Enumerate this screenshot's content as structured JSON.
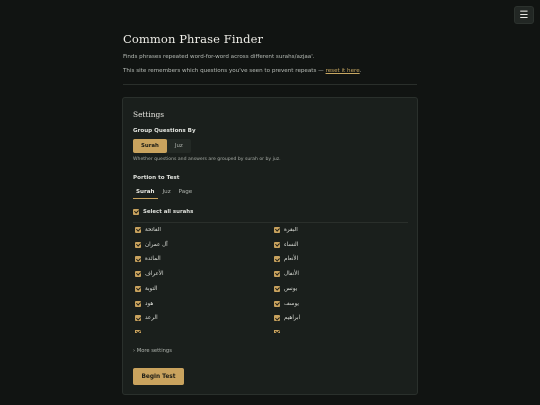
{
  "menu_icon": "☰",
  "header": {
    "title": "Common Phrase Finder",
    "subtitle": "Finds phrases repeated word-for-word across different surahs/azjaa'.",
    "remember_prefix": "This site remembers which questions you've seen to prevent repeats — ",
    "reset_link": "reset it here",
    "remember_suffix": "."
  },
  "settings": {
    "title": "Settings",
    "group_label": "Group Questions By",
    "group_options": [
      "Surah",
      "Juz"
    ],
    "group_selected": "Surah",
    "group_hint": "Whether questions and answers are grouped by surah or by juz.",
    "portion_label": "Portion to Test",
    "portion_tabs": [
      "Surah",
      "Juz",
      "Page"
    ],
    "portion_selected": "Surah",
    "select_all_label": "Select all surahs",
    "select_all_checked": true,
    "surahs": [
      {
        "name": "الفاتحة",
        "checked": true
      },
      {
        "name": "البقرة",
        "checked": true
      },
      {
        "name": "آل عمران",
        "checked": true
      },
      {
        "name": "النساء",
        "checked": true
      },
      {
        "name": "المائدة",
        "checked": true
      },
      {
        "name": "الأنعام",
        "checked": true
      },
      {
        "name": "الأعراف",
        "checked": true
      },
      {
        "name": "الأنفال",
        "checked": true
      },
      {
        "name": "التوبة",
        "checked": true
      },
      {
        "name": "يونس",
        "checked": true
      },
      {
        "name": "هود",
        "checked": true
      },
      {
        "name": "يوسف",
        "checked": true
      },
      {
        "name": "الرعد",
        "checked": true
      },
      {
        "name": "ابراهيم",
        "checked": true
      }
    ],
    "more_settings": "› More settings",
    "begin_button": "Begin Test"
  },
  "colors": {
    "background": "#111412",
    "card": "#1a1f1c",
    "accent": "#c9a35e",
    "link": "#c8a862"
  }
}
